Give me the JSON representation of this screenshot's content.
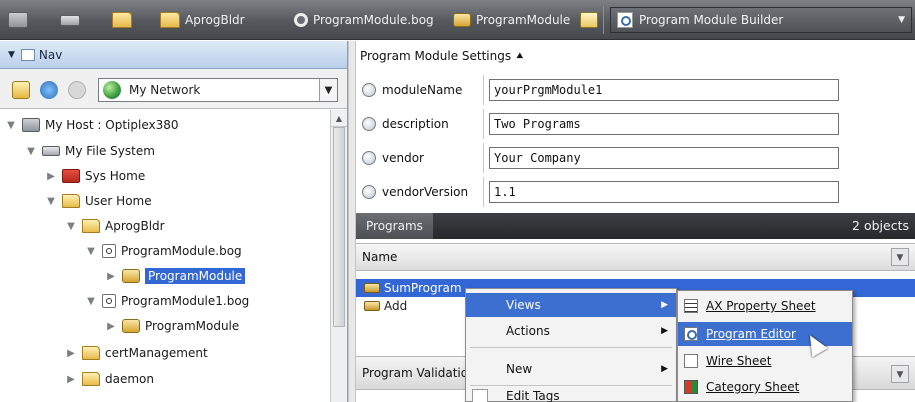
{
  "toolbar": {
    "crumbs": [
      "AprogBldr",
      "ProgramModule.bog",
      "ProgramModule"
    ],
    "view_selector": "Program Module Builder"
  },
  "nav": {
    "title": "Nav",
    "network_select": "My Network",
    "tree": [
      {
        "label": "My Host : Optiplex380",
        "icon": "host-icon"
      },
      {
        "label": "My File System",
        "icon": "drive-icon"
      },
      {
        "label": "Sys Home",
        "icon": "home-icon"
      },
      {
        "label": "User Home",
        "icon": "folder-icon"
      },
      {
        "label": "AprogBldr",
        "icon": "folder-icon"
      },
      {
        "label": "ProgramModule.bog",
        "icon": "bog-file-icon"
      },
      {
        "label": "ProgramModule",
        "icon": "program-module-icon"
      },
      {
        "label": "ProgramModule1.bog",
        "icon": "bog-file-icon"
      },
      {
        "label": "ProgramModule",
        "icon": "program-module-icon"
      },
      {
        "label": "certManagement",
        "icon": "folder-icon"
      },
      {
        "label": "daemon",
        "icon": "folder-icon"
      }
    ]
  },
  "settings": {
    "title": "Program Module Settings",
    "properties": [
      {
        "name": "moduleName",
        "value": "yourPrgmModule1"
      },
      {
        "name": "description",
        "value": "Two Programs"
      },
      {
        "name": "vendor",
        "value": "Your Company"
      },
      {
        "name": "vendorVersion",
        "value": "1.1"
      }
    ]
  },
  "programs": {
    "tab": "Programs",
    "count": "2 objects",
    "column": "Name",
    "rows": [
      "SumProgram",
      "Add"
    ],
    "validation_label": "Program Validatio"
  },
  "context_menu": {
    "items": [
      "Views",
      "Actions",
      "New",
      "Edit Tags"
    ]
  },
  "views_submenu": {
    "items": [
      "AX Property Sheet",
      "Program Editor",
      "Wire Sheet",
      "Category Sheet"
    ]
  }
}
